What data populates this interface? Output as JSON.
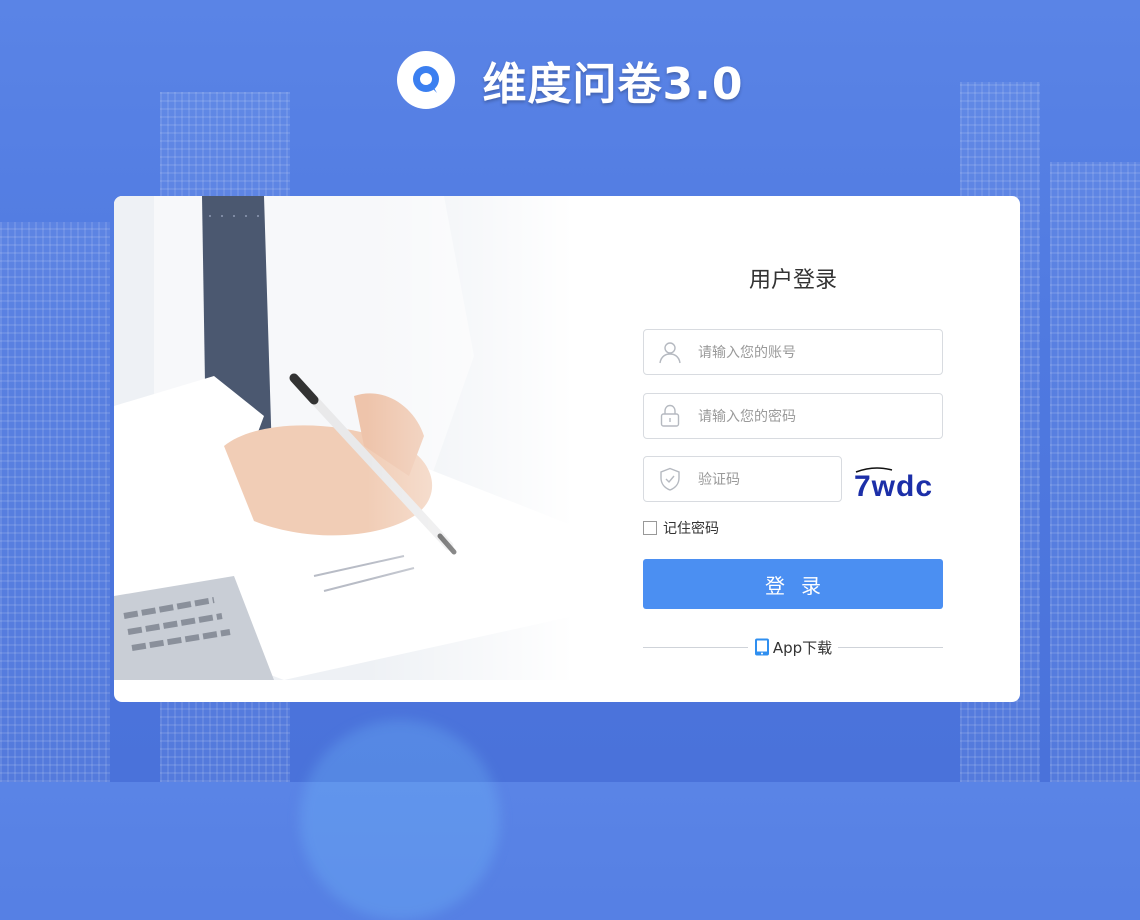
{
  "brand": {
    "title": "维度问卷3.0",
    "logo_icon": "q-logo-icon",
    "accent_color": "#3b7ff0"
  },
  "login": {
    "title": "用户登录",
    "username": {
      "placeholder": "请输入您的账号",
      "value": "",
      "icon": "user-icon"
    },
    "password": {
      "placeholder": "请输入您的密码",
      "value": "",
      "icon": "lock-icon"
    },
    "captcha": {
      "placeholder": "验证码",
      "value": "",
      "icon": "shield-check-icon",
      "image_text": "7wdc"
    },
    "remember_label": "记住密码",
    "remember_checked": false,
    "submit_label": "登录",
    "button_color": "#4b8ff2",
    "app_download_label": "App下载",
    "app_icon": "mobile-phone-icon"
  }
}
